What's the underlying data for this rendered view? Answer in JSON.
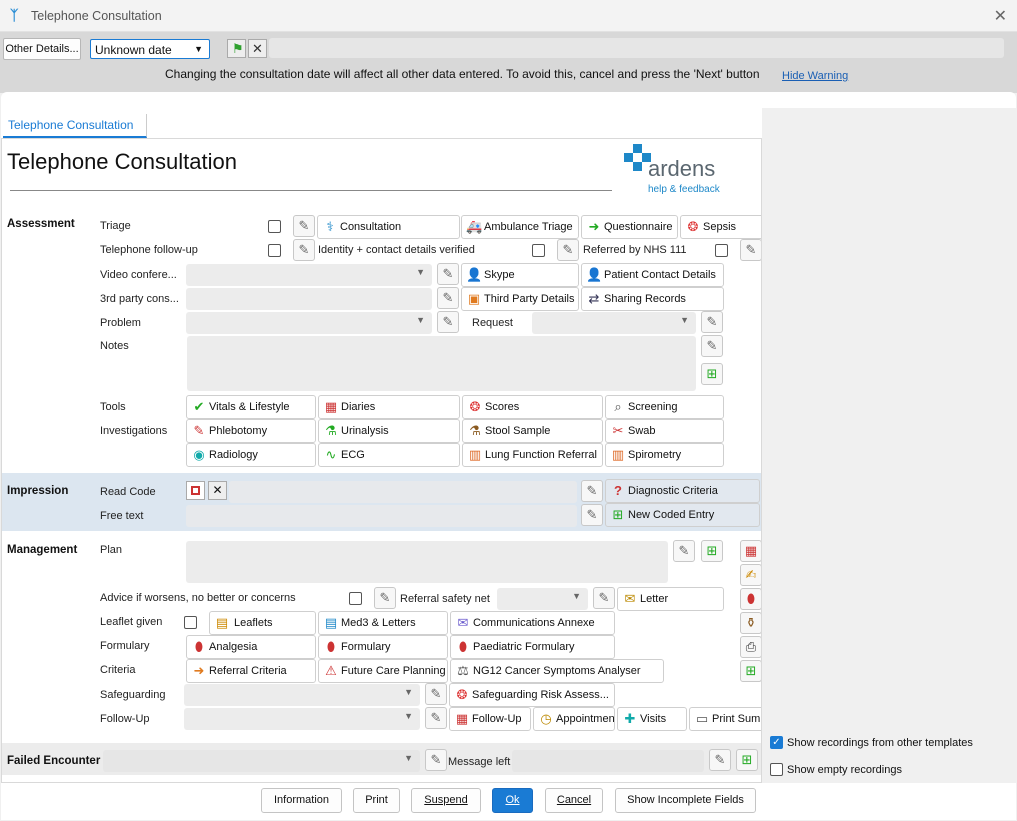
{
  "window": {
    "title": "Telephone Consultation"
  },
  "topbar": {
    "other_details": "Other Details...",
    "date_value": "Unknown date",
    "warning": "Changing the consultation date will affect all other data entered. To avoid this, cancel and press the 'Next' button",
    "hide_warning": "Hide Warning"
  },
  "tab": {
    "label": "Telephone Consultation"
  },
  "form": {
    "title": "Telephone Consultation",
    "brand": "ardens",
    "help": "help & feedback"
  },
  "assessment": {
    "section": "Assessment",
    "triage": "Triage",
    "telephone_followup": "Telephone follow-up",
    "video": "Video confere...",
    "third_party": "3rd party cons...",
    "problem": "Problem",
    "notes": "Notes",
    "request": "Request",
    "identity": "Identity + contact details verified",
    "referred_nhs111": "Referred by NHS 111",
    "tools": "Tools",
    "investigations": "Investigations",
    "buttons": {
      "consultation": "Consultation",
      "ambulance": "Ambulance Triage",
      "questionnaire": "Questionnaire",
      "sepsis": "Sepsis",
      "skype": "Skype",
      "patient_contact": "Patient Contact Details",
      "third_party_details": "Third Party Details",
      "sharing_records": "Sharing Records",
      "vitals": "Vitals & Lifestyle",
      "diaries": "Diaries",
      "scores": "Scores",
      "screening": "Screening",
      "phlebotomy": "Phlebotomy",
      "urinalysis": "Urinalysis",
      "stool": "Stool Sample",
      "swab": "Swab",
      "radiology": "Radiology",
      "ecg": "ECG",
      "lung": "Lung Function Referral",
      "spirometry": "Spirometry"
    }
  },
  "impression": {
    "section": "Impression",
    "read_code": "Read Code",
    "free_text": "Free text",
    "diagnostic_criteria": "Diagnostic Criteria",
    "new_coded_entry": "New Coded Entry"
  },
  "management": {
    "section": "Management",
    "plan": "Plan",
    "advice": "Advice if worsens, no better or concerns",
    "referral_safety_net": "Referral safety net",
    "letter": "Letter",
    "leaflet_given": "Leaflet given",
    "leaflets": "Leaflets",
    "med3": "Med3 & Letters",
    "comms_annexe": "Communications Annexe",
    "formulary": "Formulary",
    "analgesia": "Analgesia",
    "formulary_btn": "Formulary",
    "paediatric": "Paediatric Formulary",
    "criteria": "Criteria",
    "referral_criteria": "Referral Criteria",
    "future_care": "Future Care Planning",
    "ng12": "NG12 Cancer Symptoms Analyser",
    "safeguarding": "Safeguarding",
    "safeguarding_risk": "Safeguarding Risk Assess...",
    "followup": "Follow-Up",
    "followup_btn": "Follow-Up",
    "appointment": "Appointmen...",
    "visits": "Visits",
    "print_summ": "Print Summ"
  },
  "failed": {
    "section": "Failed Encounter",
    "message_left": "Message left"
  },
  "right": {
    "show_recordings": "Show recordings from other templates",
    "show_empty": "Show empty recordings"
  },
  "footer": {
    "information": "Information",
    "print": "Print",
    "suspend": "Suspend",
    "ok": "Ok",
    "cancel": "Cancel",
    "show_incomplete": "Show Incomplete Fields"
  },
  "colors": {
    "accent": "#1a7bd4",
    "brand": "#1e88c8",
    "impression_bg": "#dce6f0"
  }
}
